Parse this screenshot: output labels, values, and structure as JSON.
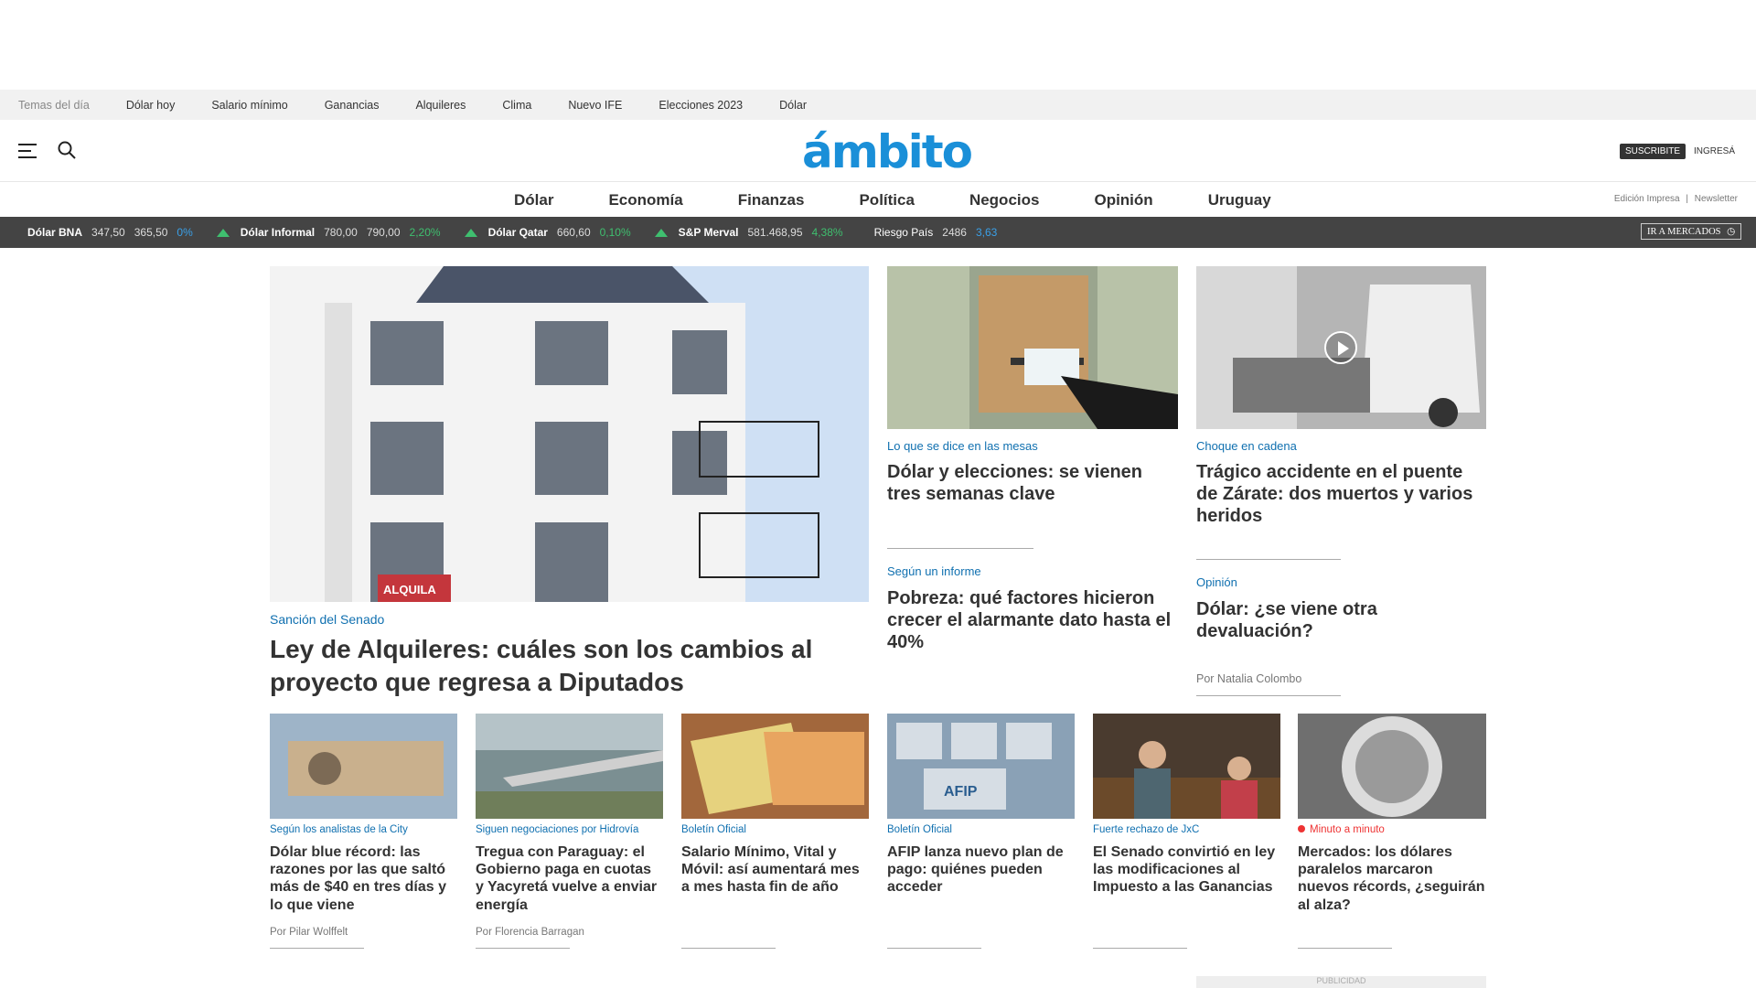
{
  "topics": {
    "label": "Temas del día",
    "items": [
      "Dólar hoy",
      "Salario mínimo",
      "Ganancias",
      "Alquileres",
      "Clima",
      "Nuevo IFE",
      "Elecciones 2023",
      "Dólar"
    ]
  },
  "header": {
    "logo": "ámbito",
    "subscribe": "SUSCRIBITE",
    "login": "INGRESÁ"
  },
  "nav": {
    "items": [
      "Dólar",
      "Economía",
      "Finanzas",
      "Política",
      "Negocios",
      "Opinión",
      "Uruguay"
    ],
    "edition": "Edición Impresa",
    "newsletter": "Newsletter"
  },
  "ticker": {
    "items": [
      {
        "name": "Dólar BNA",
        "v1": "347,50",
        "v2": "365,50",
        "pct": "0%",
        "up": false,
        "pct_color": "blue"
      },
      {
        "name": "Dólar Informal",
        "v1": "780,00",
        "v2": "790,00",
        "pct": "2,20%",
        "up": true
      },
      {
        "name": "Dólar Qatar",
        "v1": "660,60",
        "v2": "",
        "pct": "0,10%",
        "up": true
      },
      {
        "name": "S&P Merval",
        "v1": "581.468,95",
        "v2": "",
        "pct": "4,38%",
        "up": true
      },
      {
        "name": "Riesgo País",
        "v1": "2486",
        "v2": "",
        "pct": "3,63",
        "up": false,
        "pct_color": "blue"
      }
    ],
    "markets_button": "IR A MERCADOS"
  },
  "main": {
    "kicker": "Sanción del Senado",
    "title": "Ley de Alquileres: cuáles son los cambios al proyecto que regresa a Diputados"
  },
  "side": [
    {
      "kicker": "Lo que se dice en las mesas",
      "title": "Dólar y elecciones: se vienen tres semanas clave"
    },
    {
      "kicker": "Choque en cadena",
      "title": "Trágico accidente en el puente de Zárate: dos muertos y varios heridos"
    },
    {
      "kicker": "Según un informe",
      "title": "Pobreza: qué factores hicieron crecer el alarmante dato hasta el 40%"
    },
    {
      "kicker": "Opinión",
      "title": "Dólar: ¿se viene otra devaluación?",
      "byline": "Por Natalia Colombo"
    }
  ],
  "grid": [
    {
      "kicker": "Según los analistas de la City",
      "title": "Dólar blue récord: las razones por las que saltó más de $40 en tres días y lo que viene",
      "byline": "Por Pilar Wolffelt"
    },
    {
      "kicker": "Siguen negociaciones por Hidrovía",
      "title": "Tregua con Paraguay: el Gobierno paga en cuotas y Yacyretá vuelve a enviar energía",
      "byline": "Por Florencia Barragan"
    },
    {
      "kicker": "Boletín Oficial",
      "title": "Salario Mínimo, Vital y Móvil: así aumentará mes a mes hasta fin de año"
    },
    {
      "kicker": "Boletín Oficial",
      "title": "AFIP lanza nuevo plan de pago: quiénes pueden acceder"
    },
    {
      "kicker": "Fuerte rechazo de JxC",
      "title": "El Senado convirtió en ley las modificaciones al Impuesto a las Ganancias"
    },
    {
      "kicker": "Minuto a minuto",
      "title": "Mercados: los dólares paralelos marcaron nuevos récords, ¿seguirán al alza?",
      "live": true
    }
  ],
  "ad_label": "PUBLICIDAD"
}
